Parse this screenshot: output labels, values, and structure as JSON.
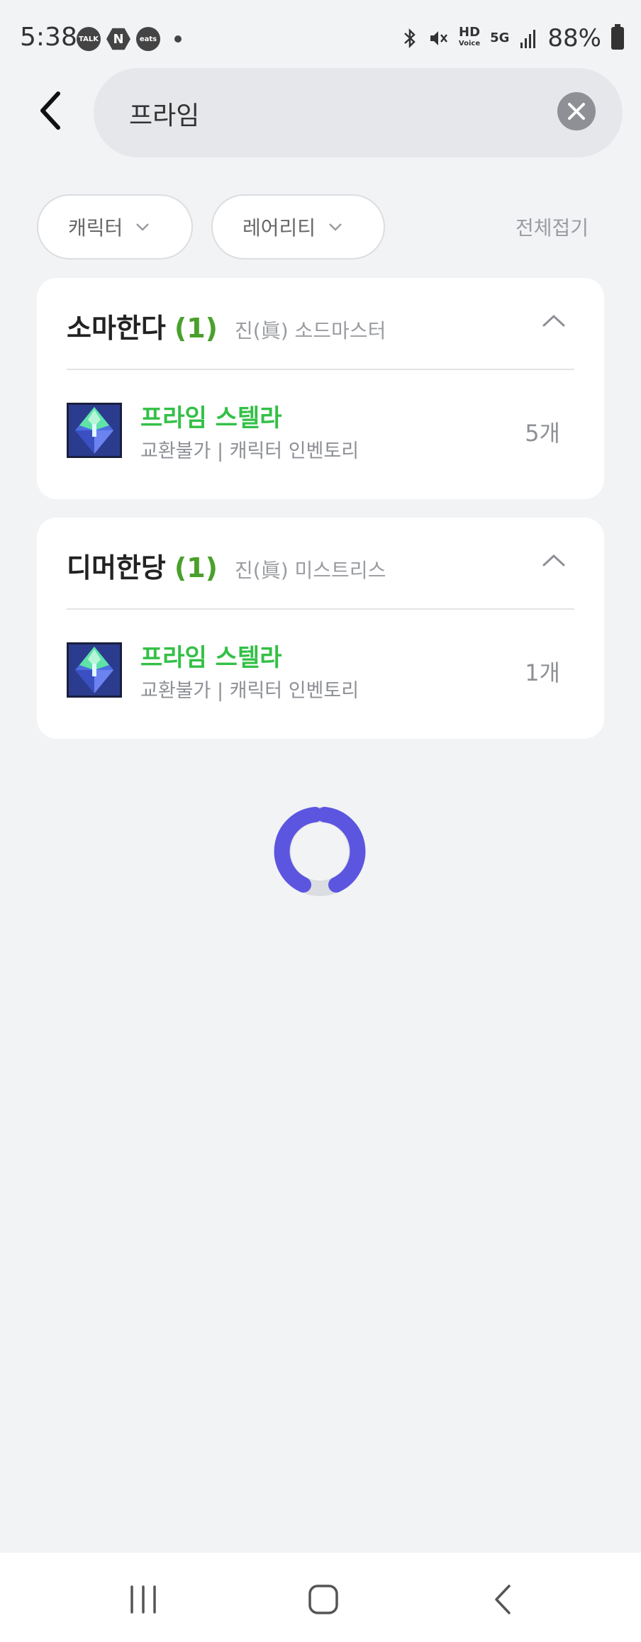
{
  "status": {
    "time": "5:38",
    "notifications": [
      "TALK",
      "N",
      "eats"
    ],
    "battery": "88%",
    "hd_top": "HD",
    "hd_bottom": "Voice",
    "network": "5G"
  },
  "search": {
    "query": "프라임"
  },
  "filters": {
    "character_label": "캐릭터",
    "rarity_label": "레어리티",
    "collapse_all": "전체접기"
  },
  "groups": [
    {
      "name": "소마한다",
      "count": "(1)",
      "class": "진(眞) 소드마스터",
      "item": {
        "name": "프라임 스텔라",
        "desc": "교환불가 | 캐릭터 인벤토리",
        "qty": "5개"
      }
    },
    {
      "name": "디머한당",
      "count": "(1)",
      "class": "진(眞) 미스트리스",
      "item": {
        "name": "프라임 스텔라",
        "desc": "교환불가 | 캐릭터 인벤토리",
        "qty": "1개"
      }
    }
  ],
  "colors": {
    "accent_green": "#33c046",
    "count_green": "#4aa02c",
    "spinner": "#5b55e0"
  },
  "icons": [
    "back-arrow-icon",
    "clear-icon",
    "chevron-down-icon",
    "chevron-up-icon",
    "loading-spinner",
    "nav-recent-icon",
    "nav-home-icon",
    "nav-back-icon"
  ]
}
